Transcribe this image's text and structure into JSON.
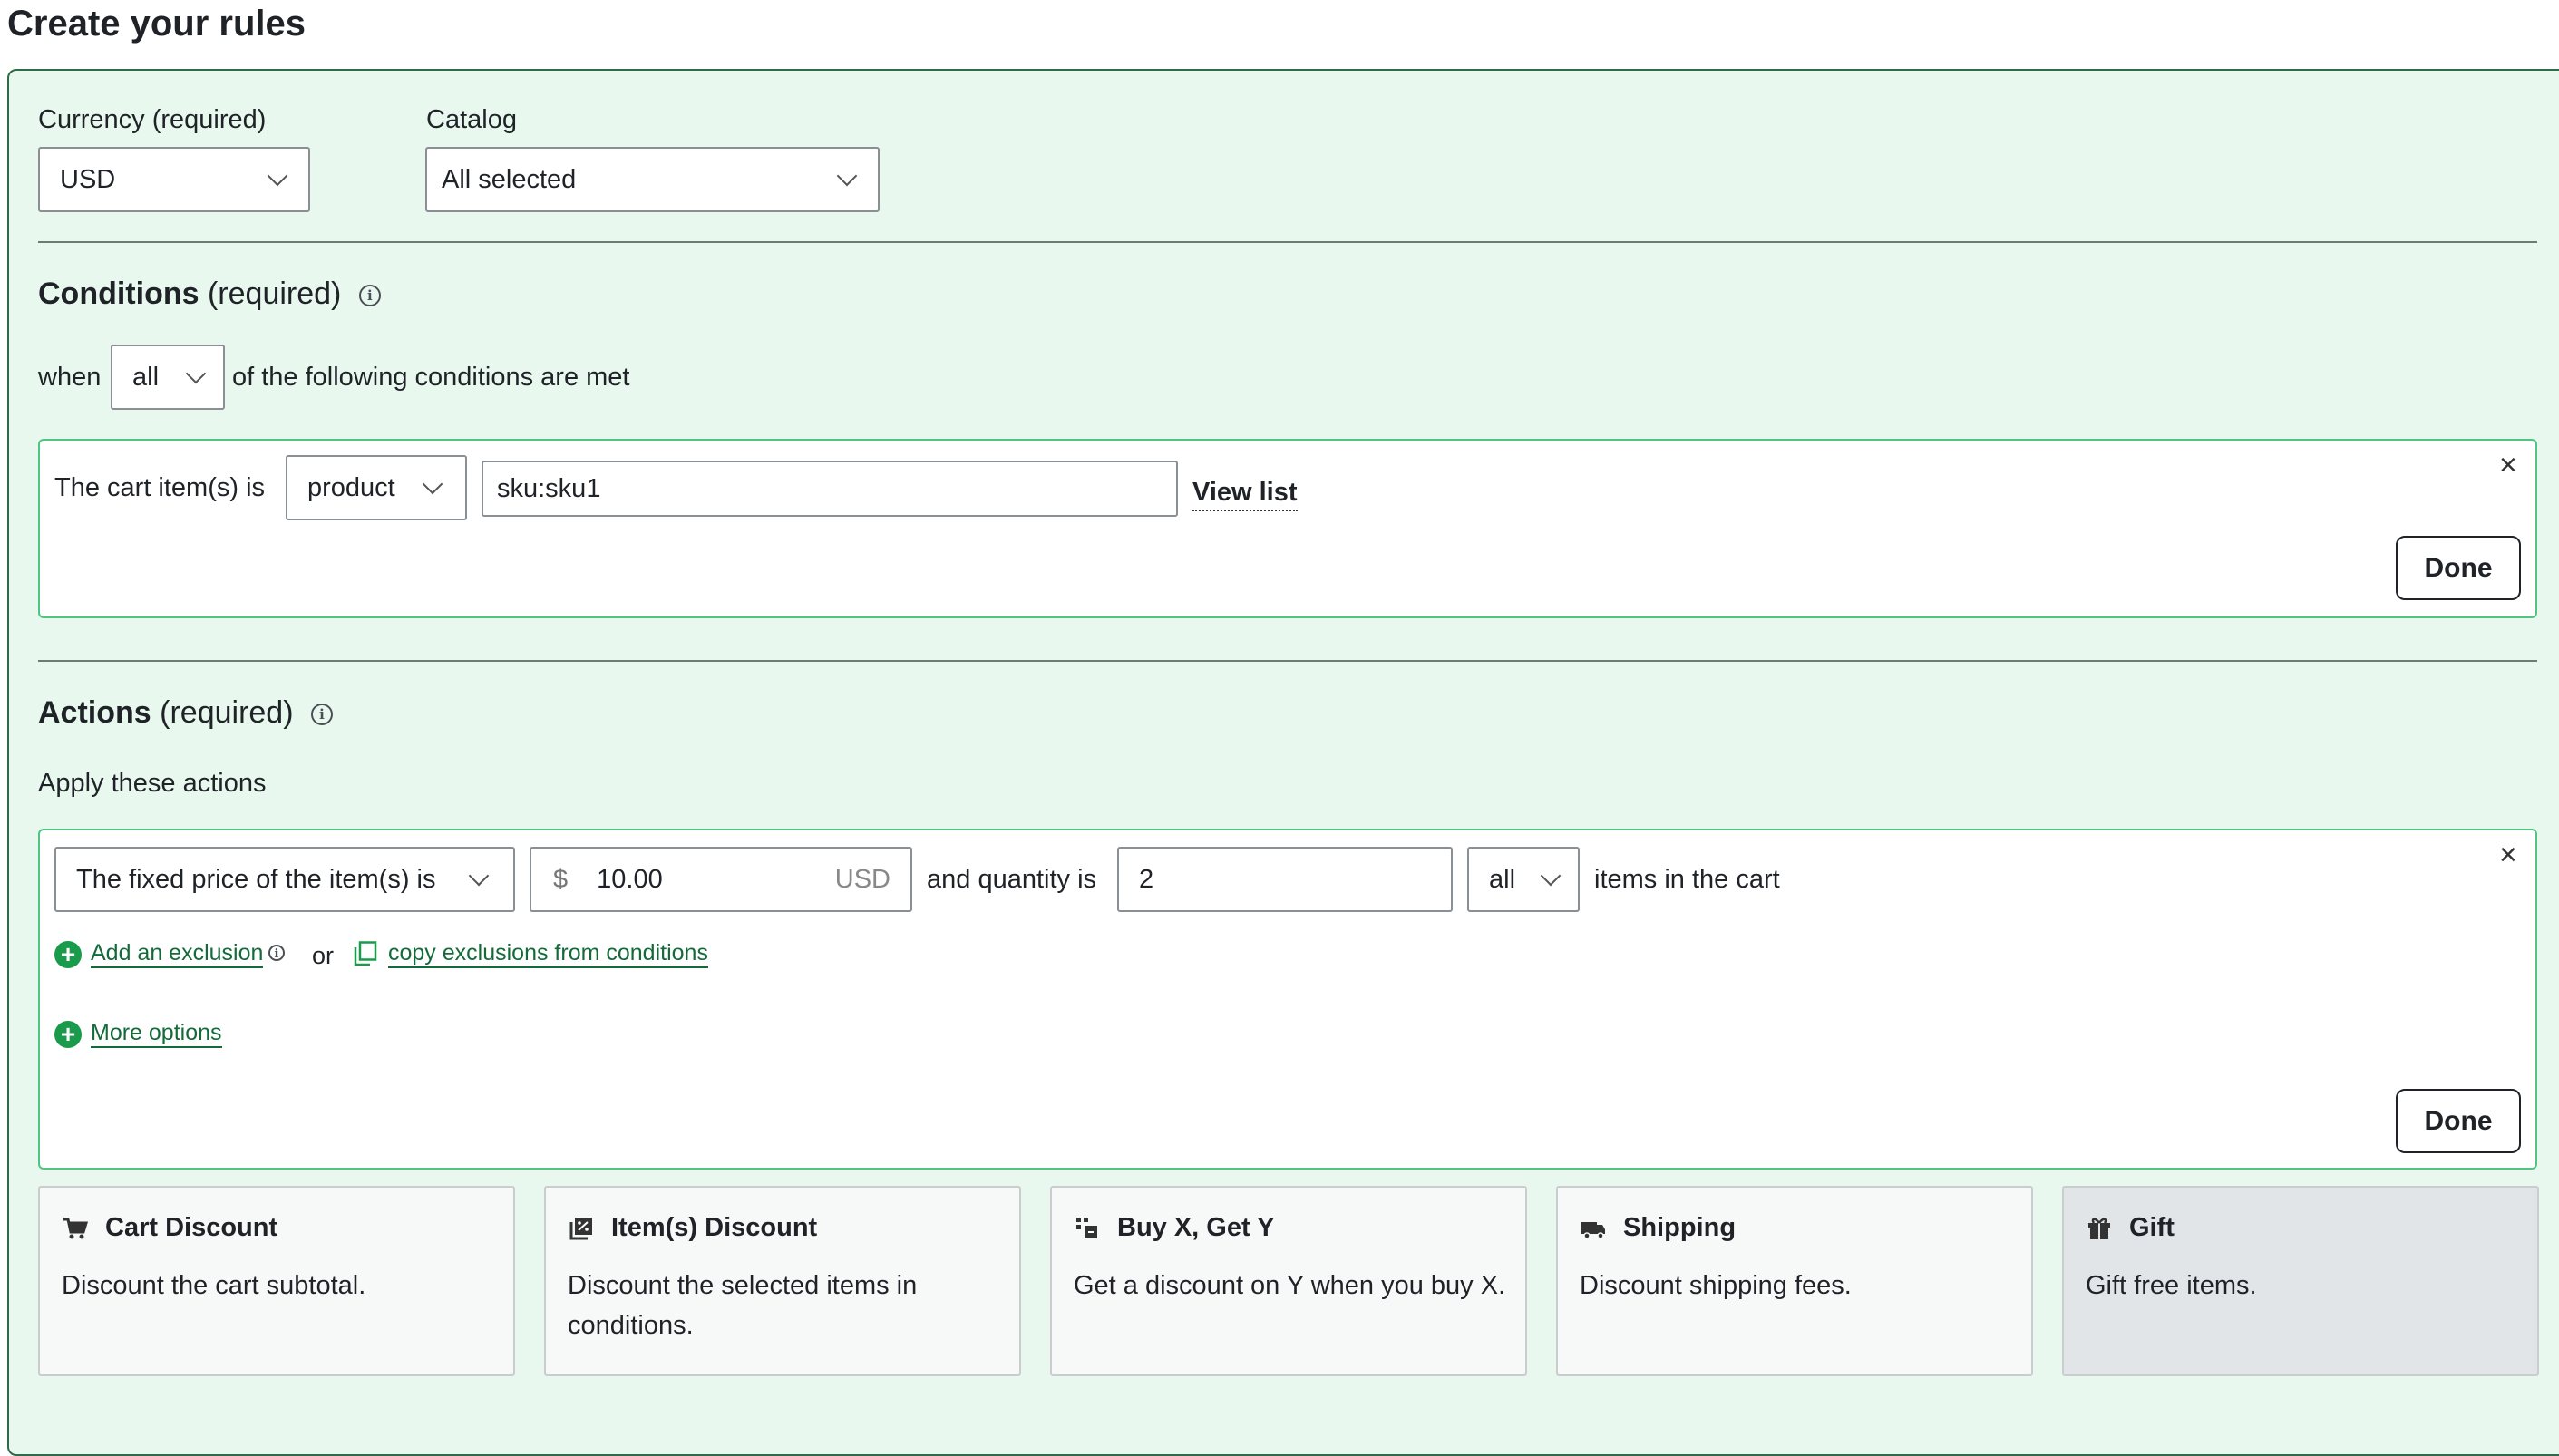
{
  "page": {
    "title": "Create your rules"
  },
  "currency": {
    "label": "Currency (required)",
    "value": "USD"
  },
  "catalog": {
    "label": "Catalog",
    "value": "All selected"
  },
  "conditions": {
    "heading_bold": "Conditions",
    "heading_suffix": "(required)",
    "info_icon": "ⓘ",
    "when_label": "when",
    "match_value": "all",
    "suffix": "of the following conditions are met",
    "rule": {
      "prefix": "The cart item(s) is",
      "type_value": "product",
      "sku_value": "sku:sku1",
      "view_list": "View list",
      "close": "×",
      "done": "Done"
    }
  },
  "actions": {
    "heading_bold": "Actions",
    "heading_suffix": "(required)",
    "info_icon": "ⓘ",
    "apply_label": "Apply these actions",
    "rule": {
      "action_type": "The fixed price of the item(s) is",
      "currency_symbol": "$",
      "price": "10.00",
      "currency_code": "USD",
      "qty_label": "and quantity is",
      "qty": "2",
      "scope_value": "all",
      "scope_suffix": "items in the cart",
      "add_exclusion": "Add an exclusion",
      "or": "or",
      "copy_exclusions": "copy exclusions from conditions",
      "more_options": "More options",
      "close": "×",
      "done": "Done",
      "plus": "+"
    }
  },
  "action_cards": [
    {
      "title": "Cart Discount",
      "desc": "Discount the cart subtotal.",
      "icon": "cart-icon"
    },
    {
      "title": "Item(s) Discount",
      "desc": "Discount the selected items in conditions.",
      "icon": "item-discount-icon"
    },
    {
      "title": "Buy X, Get Y",
      "desc": "Get a discount on Y when you buy X.",
      "icon": "buy-x-get-y-icon"
    },
    {
      "title": "Shipping",
      "desc": "Discount shipping fees.",
      "icon": "truck-icon"
    },
    {
      "title": "Gift",
      "desc": "Gift free items.",
      "icon": "gift-icon",
      "selected": true
    }
  ],
  "colors": {
    "panel_bg": "#e9f8ef",
    "panel_border": "#2f6b48",
    "rule_border": "#4fc57f",
    "link_green": "#146b3a",
    "accent_green": "#1a9b4b"
  }
}
